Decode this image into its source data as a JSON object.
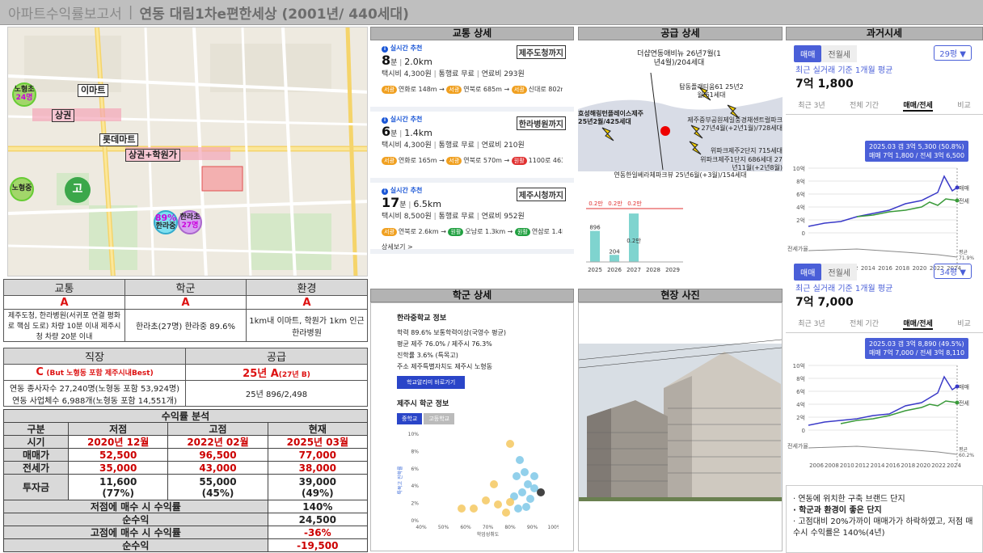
{
  "header": {
    "app": "아파트수익률보고서",
    "sep": "|",
    "title": "연동 대림1차e편한세상 (2001년/ 440세대)"
  },
  "map": {
    "labels": [
      "이마트",
      "상권",
      "롯데마트",
      "상권+학원가"
    ],
    "circles": [
      {
        "t": "노형초",
        "s": "24명"
      },
      {
        "t": "노형중",
        "s": ""
      },
      {
        "t": "고",
        "s": ""
      },
      {
        "t": "89%",
        "s": "한라중"
      },
      {
        "t": "한라초",
        "s": "27명"
      }
    ]
  },
  "grades1": {
    "headers": [
      "교통",
      "학군",
      "환경"
    ],
    "grades": [
      "A",
      "A",
      "A"
    ],
    "desc": [
      "제주도청, 한라병원(서귀포 연결 평화로 핵심 도로) 차량 10분 이내 제주시청 차량 20분 이내",
      "한라초(27명) 한라중 89.6%",
      "1km내 이마트, 학원가 1km 인근 한라병원"
    ]
  },
  "grades2": {
    "headers": [
      "직장",
      "공급"
    ],
    "grade_job": "C",
    "grade_job_note": "(But 노형동 포함 제주시내Best)",
    "grade_supply": "25년 A",
    "grade_supply_note": "(27년 B)",
    "desc_job_1": "연동 종사자수 27,240명(노형동 포함 53,924명)",
    "desc_job_2": "연동 사업체수 6,988개(노형동 포함 14,551개)",
    "desc_supply": "25년 896/2,498"
  },
  "profit": {
    "title": "수익률 분석",
    "cols": [
      "구분",
      "저점",
      "고점",
      "현재"
    ],
    "rows": [
      {
        "k": "시기",
        "v": [
          "2020년 12월",
          "2022년 02월",
          "2025년 03월"
        ]
      },
      {
        "k": "매매가",
        "v": [
          "52,500",
          "96,500",
          "77,000"
        ]
      },
      {
        "k": "전세가",
        "v": [
          "35,000",
          "43,000",
          "38,000"
        ]
      },
      {
        "k": "투자금",
        "v": [
          "11,600",
          "55,000",
          "39,000"
        ],
        "p": [
          "(77%)",
          "(45%)",
          "(49%)"
        ]
      }
    ],
    "summary": [
      {
        "k": "저점에 매수 시 수익률",
        "v": "140%"
      },
      {
        "k": "순수익",
        "v": "24,500"
      },
      {
        "k": "고점에 매수 시 수익률",
        "v": "-36%"
      },
      {
        "k": "순수익",
        "v": "-19,500"
      }
    ]
  },
  "panels": {
    "transport": "교통 상세",
    "supply": "공급 상세",
    "price": "과거시세",
    "school": "학군 상세",
    "photo": "현장 사진"
  },
  "transport": [
    {
      "rec": "실시간 추천",
      "dest": "제주도청까지",
      "min": "8",
      "unit": "분",
      "km": "2.0km",
      "fare": "택시비 4,300원",
      "toll": "통행료 무료",
      "fuel": "연료비 293원",
      "route": [
        {
          "p": "서광",
          "c": "#f0a020",
          "t": "연화로 148m →"
        },
        {
          "p": "서광",
          "c": "#f0a020",
          "t": "연북로 685m →"
        },
        {
          "p": "서광",
          "c": "#f0a020",
          "t": "신대로 802m"
        }
      ]
    },
    {
      "rec": "실시간 추천",
      "dest": "한라병원까지",
      "min": "6",
      "unit": "분",
      "km": "1.4km",
      "fare": "택시비 4,300원",
      "toll": "통행료 무료",
      "fuel": "연료비 210원",
      "route": [
        {
          "p": "서광",
          "c": "#f0a020",
          "t": "연화로 165m →"
        },
        {
          "p": "서광",
          "c": "#f0a020",
          "t": "연북로 570m →"
        },
        {
          "p": "원활",
          "c": "#e03030",
          "t": "1100로 463m"
        }
      ]
    },
    {
      "rec": "실시간 추천",
      "dest": "제주시청까지",
      "min": "17",
      "unit": "분",
      "km": "6.5km",
      "fare": "택시비 8,500원",
      "toll": "통행료 무료",
      "fuel": "연료비 952원",
      "route": [
        {
          "p": "서광",
          "c": "#f0a020",
          "t": "연북로 2.6km →"
        },
        {
          "p": "원활",
          "c": "#20a040",
          "t": "오남로 1.3km →"
        },
        {
          "p": "원활",
          "c": "#20a040",
          "t": "연삼로 1.4km"
        }
      ],
      "more": "상세보기 >"
    }
  ],
  "supply": {
    "items": [
      "더샵연동애비뉴 26년7월(1년4월)/204세대",
      "탐동플래티움61 25년2월/61세대",
      "효성해링턴플레이스제주 25년2월/425세대",
      "제주중부공원제일풍경채센트럴파크 27년4월(+2년1월)/728세대",
      "위파크제주2단지 715세대",
      "위파크제주1단지 686세대 27년11월(+2년8월)",
      "연동한일베라체파크뷰 25년6월(+3월)/154세대"
    ],
    "bars": {
      "x": [
        "2025",
        "2026",
        "2027",
        "2028",
        "2029"
      ],
      "values": [
        896,
        204,
        1398,
        0,
        0
      ],
      "labels": [
        "896",
        "204",
        "",
        "",
        ""
      ],
      "top": [
        "0.2만",
        "0.2만",
        "0.2만"
      ],
      "inner": "0.2만"
    }
  },
  "price": [
    {
      "tab1": "매매",
      "tab2": "전월세",
      "sel": "29평 ▼",
      "sub": "최근 실거래 기준 1개월 평균",
      "val": "7억 1,800",
      "stabs": [
        "최근 3년",
        "전체 기간",
        "매매/전세",
        "비교"
      ],
      "tip1": "2025.03 갭 3억 5,300 (50.8%)",
      "tip2": "매매 7억 1,800 / 전세 3억 6,500",
      "yt": [
        "10억",
        "8억",
        "6억",
        "4억",
        "2억",
        "0"
      ],
      "yl": "전세가율",
      "xt": [
        "2008",
        "2010",
        "2012",
        "2014",
        "2016",
        "2018",
        "2020",
        "2022",
        "2024"
      ],
      "s1": "매매",
      "s2": "전세",
      "s3": "평균",
      "s3v": "71.9%"
    },
    {
      "tab1": "매매",
      "tab2": "전월세",
      "sel": "34평 ▼",
      "sub": "최근 실거래 기준 1개월 평균",
      "val": "7억 7,000",
      "stabs": [
        "최근 3년",
        "전체 기간",
        "매매/전세",
        "비교"
      ],
      "tip1": "2025.03 갭 3억 8,890 (49.5%)",
      "tip2": "매매 7억 7,000 / 전세 3억 8,110",
      "yt": [
        "10억",
        "8억",
        "6억",
        "4억",
        "2억",
        "0"
      ],
      "yl": "전세가율",
      "xt": [
        "2006",
        "2008",
        "2010",
        "2012",
        "2014",
        "2016",
        "2018",
        "2020",
        "2022",
        "2024"
      ],
      "s1": "매매",
      "s2": "전세",
      "s3": "평균",
      "s3v": "60.2%"
    }
  ],
  "school": {
    "title": "한라중학교 정보",
    "l1": "학력 89.6% 보통학력이상(국영수 평균)",
    "l2": "평균 제주 76.0% / 제주시 76.3%",
    "l3": "진학률 3.6% (특목고)",
    "l4": "주소 제주특별자치도 제주시 노형동",
    "btn": "학교알리미 바로가기",
    "t2": "제주시 학군 정보",
    "tab1": "중학교",
    "tab2": "고등학교",
    "xticks": [
      "40%",
      "50%",
      "60%",
      "70%",
      "80%",
      "90%",
      "100%"
    ],
    "yticks": [
      "10%",
      "8%",
      "6%",
      "4%",
      "2%",
      "0%"
    ],
    "xlabel": "학업성취도",
    "ylabel": "특목고 진학률"
  },
  "notes": [
    "· 연동에 위치한 구축 브랜드 단지",
    "· 학군과 환경이 좋은 단지",
    "· 고점대비 20%가까이 매매가가 하락하였고, 저점 매수시 수익률은 140%(4년)"
  ]
}
